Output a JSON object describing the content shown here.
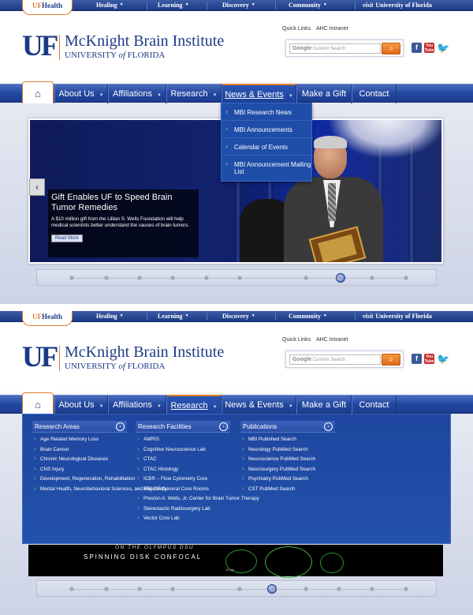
{
  "ufhealth": {
    "uf": "UF",
    "health": "Health"
  },
  "topnav": [
    {
      "label": "Healing"
    },
    {
      "label": "Learning"
    },
    {
      "label": "Discovery"
    },
    {
      "label": "Community"
    }
  ],
  "visit": {
    "italic": "visit",
    "text": "University of Florida"
  },
  "header": {
    "logo": "UF",
    "title": "McKnight Brain Institute",
    "sub_pre": "UNIVERSITY ",
    "sub_of": "of",
    "sub_post": " FLORIDA"
  },
  "quick_links": "Quick Links",
  "intranet": "AHC Intranet",
  "search": {
    "google": "Google",
    "placeholder": "Custom Search",
    "button": "⌕"
  },
  "social": {
    "facebook": "f",
    "youtube": "You Tube",
    "twitter": "🐦"
  },
  "colors": {
    "brand_blue": "#1b3a85",
    "brand_orange": "#e37b2b",
    "nav_blue": "#2348a0"
  },
  "mainnav": {
    "home_icon": "⌂",
    "about": "About Us",
    "affiliations": "Affiliations",
    "research": "Research",
    "news": "News & Events",
    "gift": "Make a Gift",
    "contact": "Contact"
  },
  "news_dropdown": [
    "MBI Research News",
    "MBI Announcements",
    "Calendar of Events",
    "MBI Announcement Mailing List"
  ],
  "slide": {
    "prev": "‹",
    "title": "Gift Enables UF to Speed Brain Tumor Remedies",
    "text": "A $10 million gift from the Lillian S. Wells Foundation will help medical scientists better understand the causes of brain tumors.",
    "button": "Read More"
  },
  "pager1_active_index": 6,
  "pager2_active_index": 4,
  "research_menu": {
    "areas": {
      "heading": "Research Areas",
      "items": [
        "Age Related Memory Loss",
        "Brain Cancer",
        "Chronic Neurological Diseases",
        "CNS Injury",
        "Development, Regeneration, Rehabilitation",
        "Mental Health, Neurobehavioral Sciences, and Psychiatry"
      ]
    },
    "facilities": {
      "heading": "Research Facilities",
      "items": [
        "AMRIS",
        "Cognitive Neuroscience Lab",
        "CTAC",
        "CTAC Histology",
        "ICBR – Flow Cytometry Core",
        "MBI-UF General Core Rooms",
        "Preston A. Wells, Jr. Center for Brain Tumor Therapy",
        "Stereotactic Radiosurgery Lab",
        "Vector Core Lab"
      ]
    },
    "publications": {
      "heading": "Publications",
      "items": [
        "MBI Publshed Search",
        "Neurology PubMed Search",
        "Neuroscience PubMed Search",
        "Neurosurgery PubMed Search",
        "Psychiatry PubMed Search",
        "CST PubMed Search"
      ]
    },
    "arrow": "›"
  },
  "confocal": {
    "line1": "ON THE OLYMPUS DSU",
    "line2": "SPINNING DISK CONFOCAL",
    "scale": "10 μm"
  }
}
